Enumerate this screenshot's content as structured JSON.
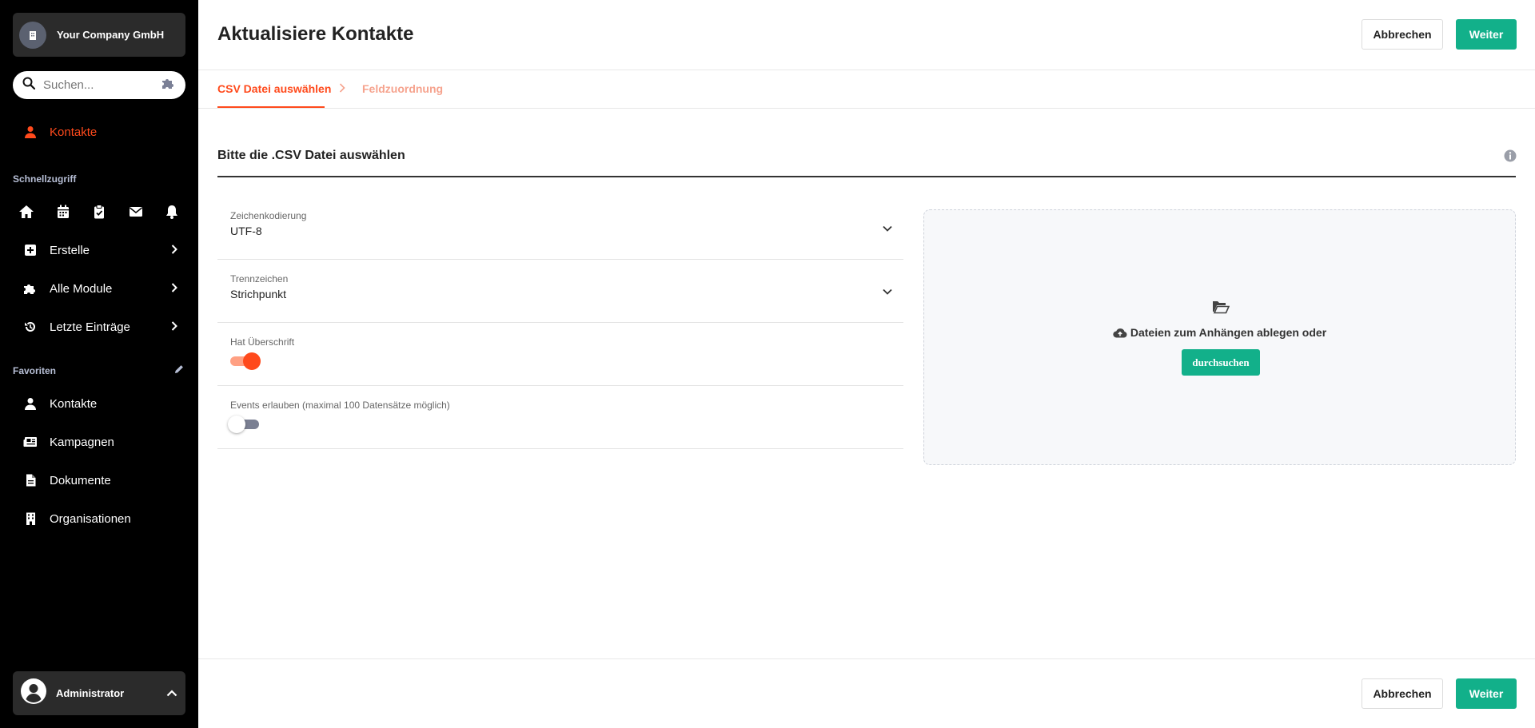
{
  "sidebar": {
    "company_name": "Your Company GmbH",
    "search_placeholder": "Suchen...",
    "active_item": "Kontakte",
    "quick_title": "Schnellzugriff",
    "menu": [
      {
        "label": "Erstelle"
      },
      {
        "label": "Alle Module"
      },
      {
        "label": "Letzte Einträge"
      }
    ],
    "favorites_title": "Favoriten",
    "favorites": [
      {
        "label": "Kontakte"
      },
      {
        "label": "Kampagnen"
      },
      {
        "label": "Dokumente"
      },
      {
        "label": "Organisationen"
      }
    ],
    "user_name": "Administrator",
    "quick_icons": [
      "home-icon",
      "calendar-icon",
      "clipboard-check-icon",
      "envelope-icon",
      "bell-icon"
    ]
  },
  "header": {
    "title": "Aktualisiere Kontakte",
    "cancel_label": "Abbrechen",
    "next_label": "Weiter"
  },
  "steps": {
    "step1": "CSV Datei auswählen",
    "step2": "Feldzuordnung"
  },
  "form": {
    "section_title": "Bitte die .CSV Datei auswählen",
    "encoding_label": "Zeichenkodierung",
    "encoding_value": "UTF-8",
    "delimiter_label": "Trennzeichen",
    "delimiter_value": "Strichpunkt",
    "header_label": "Hat Überschrift",
    "header_on": true,
    "events_label": "Events erlauben (maximal 100 Datensätze möglich)",
    "events_on": false
  },
  "dropzone": {
    "text": "Dateien zum Anhängen ablegen oder",
    "browse_label": "durchsuchen"
  },
  "footer": {
    "cancel_label": "Abbrechen",
    "next_label": "Weiter"
  },
  "colors": {
    "accent": "#ff4a1c",
    "primary": "#12b08a",
    "sidebar_bg": "#000000"
  }
}
